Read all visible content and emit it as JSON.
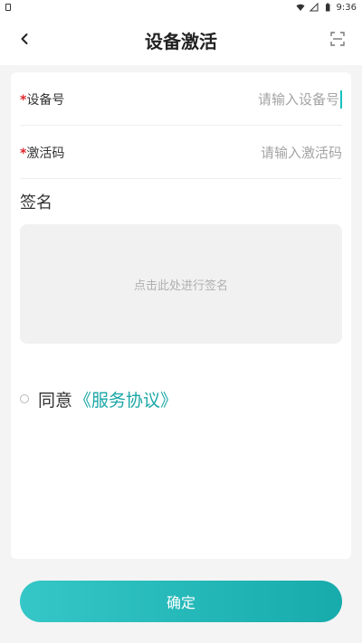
{
  "status_bar": {
    "time": "9:36"
  },
  "header": {
    "title": "设备激活"
  },
  "form": {
    "device_number": {
      "star": "*",
      "label": "设备号",
      "placeholder": "请输入设备号",
      "value": ""
    },
    "activation_code": {
      "star": "*",
      "label": "激活码",
      "placeholder": "请输入激活码",
      "value": ""
    }
  },
  "signature": {
    "title": "签名",
    "placeholder": "点击此处进行签名"
  },
  "agreement": {
    "prefix": "同意",
    "link": "《服务协议》",
    "checked": false
  },
  "footer": {
    "confirm_label": "确定"
  },
  "colors": {
    "accent": "#1aa6a6",
    "required_star": "#e0262b",
    "background": "#f4f4f4"
  },
  "icons": {
    "back": "chevron-left-icon",
    "scan": "scan-icon"
  }
}
